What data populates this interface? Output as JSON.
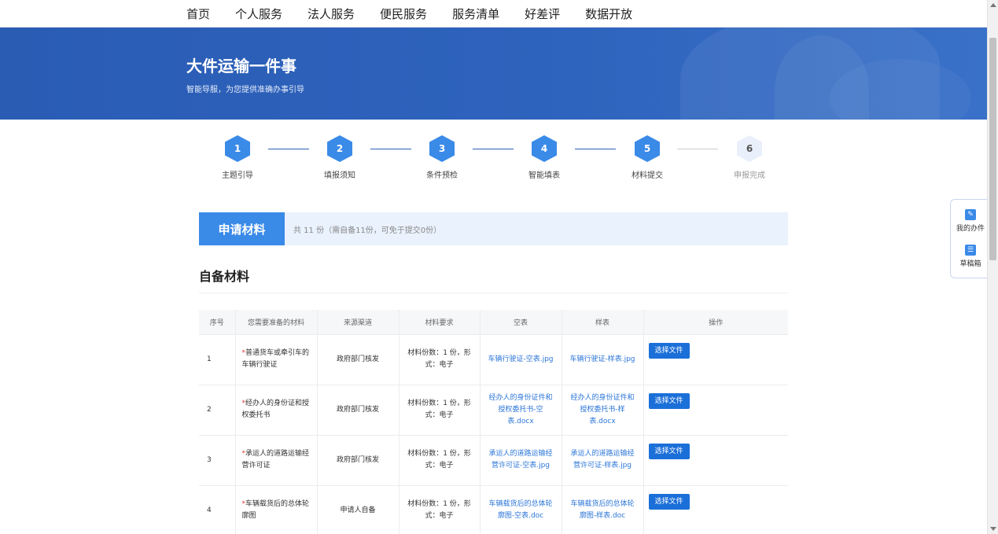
{
  "nav": {
    "items": [
      "首页",
      "个人服务",
      "法人服务",
      "便民服务",
      "服务清单",
      "好差评",
      "数据开放"
    ]
  },
  "banner": {
    "title": "大件运输一件事",
    "subtitle": "智能导服，为您提供准确办事引导"
  },
  "steps": [
    {
      "num": "1",
      "label": "主题引导",
      "status": "done"
    },
    {
      "num": "2",
      "label": "填报须知",
      "status": "done"
    },
    {
      "num": "3",
      "label": "条件预检",
      "status": "done"
    },
    {
      "num": "4",
      "label": "智能填表",
      "status": "done"
    },
    {
      "num": "5",
      "label": "材料提交",
      "status": "done"
    },
    {
      "num": "6",
      "label": "申报完成",
      "status": "todo"
    }
  ],
  "section": {
    "tab": "申请材料",
    "summary": "共 11 份（需自备11份，可免于提交0份）",
    "self_title": "自备材料"
  },
  "table": {
    "headers": [
      "序号",
      "您需要准备的材料",
      "来源渠道",
      "材料要求",
      "空表",
      "样表",
      "操作"
    ],
    "rows": [
      {
        "no": "1",
        "name": "普通货车或牵引车的车辆行驶证",
        "source": "政府部门核发",
        "req": "材料份数：1 份，形式：电子",
        "blank": "车辆行驶证-空表.jpg",
        "sample": "车辆行驶证-样表.jpg",
        "action": "选择文件"
      },
      {
        "no": "2",
        "name": "经办人的身份证和授权委托书",
        "source": "政府部门核发",
        "req": "材料份数：1 份，形式：电子",
        "blank": "经办人的身份证件和授权委托书-空表.docx",
        "sample": "经办人的身份证件和授权委托书-样表.docx",
        "action": "选择文件"
      },
      {
        "no": "3",
        "name": "承运人的道路运输经营许可证",
        "source": "政府部门核发",
        "req": "材料份数：1 份，形式：电子",
        "blank": "承运人的道路运输经营许可证-空表.jpg",
        "sample": "承运人的道路运输经营许可证-样表.jpg",
        "action": "选择文件"
      },
      {
        "no": "4",
        "name": "车辆载货后的总体轮廓图",
        "source": "申请人自备",
        "req": "材料份数：1 份，形式：电子",
        "blank": "车辆载货后的总体轮廓图-空表.doc",
        "sample": "车辆载货后的总体轮廓图-样表.doc",
        "action": "选择文件"
      }
    ]
  },
  "float": {
    "my_affairs": "我的办件",
    "drafts": "草稿箱"
  },
  "colors": {
    "primary": "#3a8ae8",
    "banner": "#2a5cb4",
    "link": "#2c76d8",
    "required": "#e53935"
  }
}
